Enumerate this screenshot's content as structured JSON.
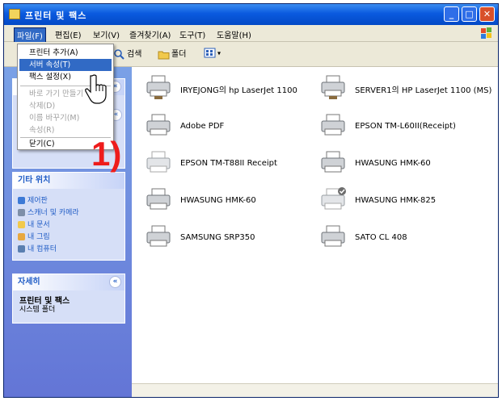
{
  "window": {
    "title": "프린터 및 팩스"
  },
  "menubar": {
    "file": "파일(F)",
    "edit": "편집(E)",
    "view": "보기(V)",
    "favorites": "즐겨찾기(A)",
    "tools": "도구(T)",
    "help": "도움말(H)"
  },
  "file_menu": {
    "items": [
      "프린터 추가(A)",
      "서버 속성(T)",
      "팩스 설정(X)",
      "바로 가기 만들기",
      "삭제(D)",
      "이름 바꾸기(M)",
      "속성(R)",
      "닫기(C)"
    ]
  },
  "toolbar": {
    "search": "검색",
    "folders": "폴더"
  },
  "taskpane": {
    "other_places": {
      "title": "기타 위치",
      "links": [
        "제어판",
        "스캐너 및 카메라",
        "내 문서",
        "내 그림",
        "내 컴퓨터"
      ]
    },
    "details": {
      "title": "자세히",
      "line1": "프린터 및 팩스",
      "line2": "시스템 폴더"
    }
  },
  "printers": [
    {
      "name": "IRYEJONG의 hp LaserJet 1100"
    },
    {
      "name": "SERVER1의 HP LaserJet 1100 (MS)"
    },
    {
      "name": "Adobe PDF"
    },
    {
      "name": "EPSON TM-L60II(Receipt)"
    },
    {
      "name": "EPSON TM-T88II Receipt"
    },
    {
      "name": "HWASUNG HMK-60"
    },
    {
      "name": "HWASUNG HMK-60"
    },
    {
      "name": "HWASUNG HMK-825"
    },
    {
      "name": "SAMSUNG SRP350"
    },
    {
      "name": "SATO CL 408"
    }
  ],
  "annotation": "1)",
  "colors": {
    "accent": "#316ac5",
    "annotation": "#ee1c1c",
    "titlebar": "#0a5adf"
  }
}
